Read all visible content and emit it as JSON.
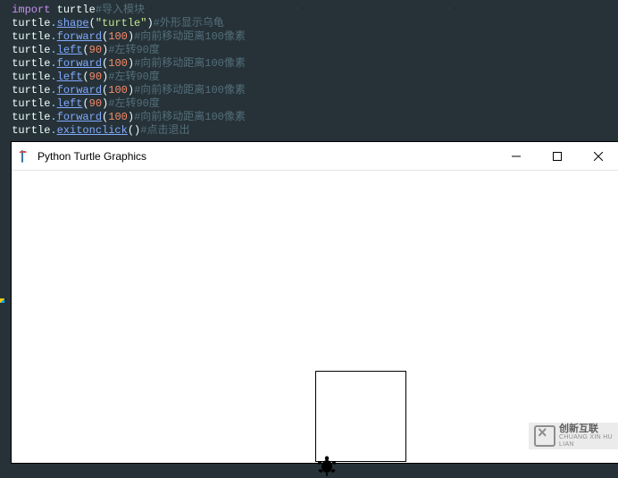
{
  "code": {
    "lines": [
      {
        "tokens": [
          {
            "t": " ",
            "c": "obj"
          },
          {
            "t": "import",
            "c": "kw"
          },
          {
            "t": " ",
            "c": "obj"
          },
          {
            "t": "turtle",
            "c": "mod"
          },
          {
            "t": "#导入模块",
            "c": "cmt"
          }
        ]
      },
      {
        "tokens": [
          {
            "t": " turtle",
            "c": "obj"
          },
          {
            "t": ".",
            "c": "dot"
          },
          {
            "t": "shape",
            "c": "fn"
          },
          {
            "t": "(",
            "c": "paren"
          },
          {
            "t": "\"turtle\"",
            "c": "str"
          },
          {
            "t": ")",
            "c": "paren"
          },
          {
            "t": "#外形显示乌龟",
            "c": "cmt"
          }
        ]
      },
      {
        "tokens": [
          {
            "t": " turtle",
            "c": "obj"
          },
          {
            "t": ".",
            "c": "dot"
          },
          {
            "t": "forward",
            "c": "fn"
          },
          {
            "t": "(",
            "c": "paren"
          },
          {
            "t": "100",
            "c": "num"
          },
          {
            "t": ")",
            "c": "paren"
          },
          {
            "t": "#向前移动距离100像素",
            "c": "cmt"
          }
        ]
      },
      {
        "tokens": [
          {
            "t": " turtle",
            "c": "obj"
          },
          {
            "t": ".",
            "c": "dot"
          },
          {
            "t": "left",
            "c": "fn"
          },
          {
            "t": "(",
            "c": "paren"
          },
          {
            "t": "90",
            "c": "num"
          },
          {
            "t": ")",
            "c": "paren"
          },
          {
            "t": "#左转90度",
            "c": "cmt"
          }
        ]
      },
      {
        "tokens": [
          {
            "t": " turtle",
            "c": "obj"
          },
          {
            "t": ".",
            "c": "dot"
          },
          {
            "t": "forward",
            "c": "fn"
          },
          {
            "t": "(",
            "c": "paren"
          },
          {
            "t": "100",
            "c": "num"
          },
          {
            "t": ")",
            "c": "paren"
          },
          {
            "t": "#向前移动距离100像素",
            "c": "cmt"
          }
        ]
      },
      {
        "tokens": [
          {
            "t": " turtle",
            "c": "obj"
          },
          {
            "t": ".",
            "c": "dot"
          },
          {
            "t": "left",
            "c": "fn"
          },
          {
            "t": "(",
            "c": "paren"
          },
          {
            "t": "90",
            "c": "num"
          },
          {
            "t": ")",
            "c": "paren"
          },
          {
            "t": "#左转90度",
            "c": "cmt"
          }
        ]
      },
      {
        "tokens": [
          {
            "t": " turtle",
            "c": "obj"
          },
          {
            "t": ".",
            "c": "dot"
          },
          {
            "t": "forward",
            "c": "fn"
          },
          {
            "t": "(",
            "c": "paren"
          },
          {
            "t": "100",
            "c": "num"
          },
          {
            "t": ")",
            "c": "paren"
          },
          {
            "t": "#向前移动距离100像素",
            "c": "cmt"
          }
        ]
      },
      {
        "tokens": [
          {
            "t": " turtle",
            "c": "obj"
          },
          {
            "t": ".",
            "c": "dot"
          },
          {
            "t": "left",
            "c": "fn"
          },
          {
            "t": "(",
            "c": "paren"
          },
          {
            "t": "90",
            "c": "num"
          },
          {
            "t": ")",
            "c": "paren"
          },
          {
            "t": "#左转90度",
            "c": "cmt"
          }
        ]
      },
      {
        "tokens": [
          {
            "t": " turtle",
            "c": "obj"
          },
          {
            "t": ".",
            "c": "dot"
          },
          {
            "t": "forward",
            "c": "fn"
          },
          {
            "t": "(",
            "c": "paren"
          },
          {
            "t": "100",
            "c": "num"
          },
          {
            "t": ")",
            "c": "paren"
          },
          {
            "t": "#向前移动距离100像素",
            "c": "cmt"
          }
        ]
      },
      {
        "tokens": [
          {
            "t": " turtle",
            "c": "obj"
          },
          {
            "t": ".",
            "c": "dot"
          },
          {
            "t": "exitonclick",
            "c": "fn"
          },
          {
            "t": "()",
            "c": "paren"
          },
          {
            "t": "#点击退出",
            "c": "cmt"
          }
        ]
      }
    ]
  },
  "window": {
    "title": "Python Turtle Graphics"
  },
  "watermark": {
    "line1": "创新互联",
    "line2": "CHUANG XIN HU LIAN"
  }
}
